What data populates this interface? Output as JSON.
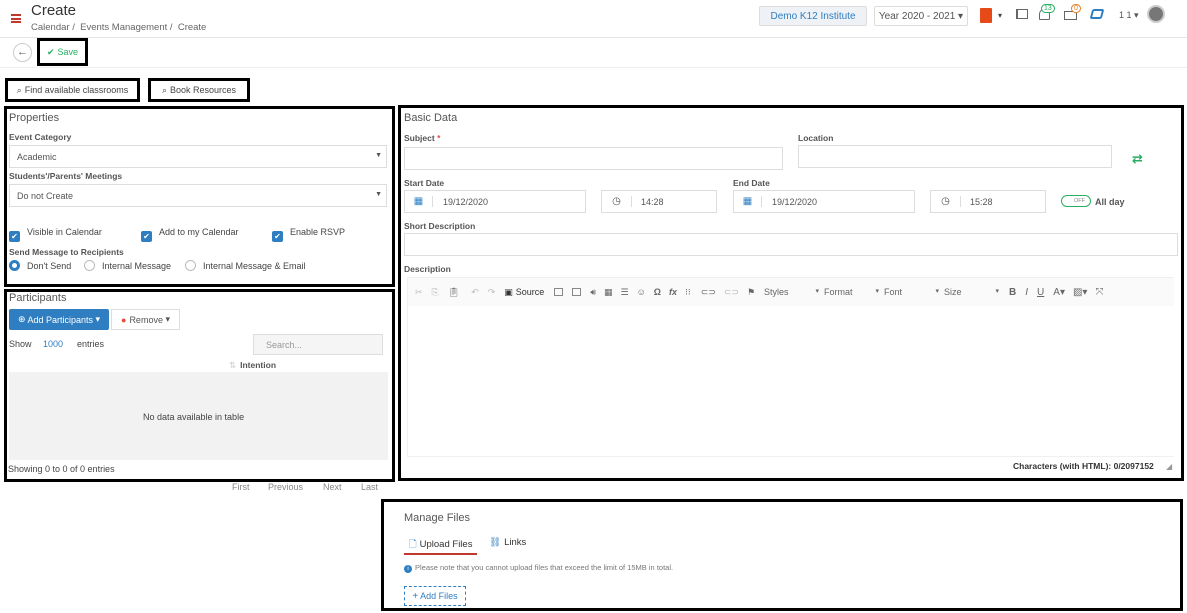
{
  "header": {
    "title": "Create",
    "breadcrumbs": [
      "Calendar",
      "Events Management",
      "Create"
    ],
    "institute": "Demo K12 Institute",
    "year": "Year 2020 - 2021",
    "notif_count": "13",
    "msg_count": "0",
    "user": "1 1"
  },
  "toolbar": {
    "save": "Save"
  },
  "actions": {
    "find_classrooms": "Find available classrooms",
    "book_resources": "Book Resources"
  },
  "properties": {
    "title": "Properties",
    "event_category_label": "Event Category",
    "event_category_value": "Academic",
    "meetings_label": "Students'/Parents' Meetings",
    "meetings_value": "Do not Create",
    "checks": [
      "Visible in Calendar",
      "Add to my Calendar",
      "Enable RSVP"
    ],
    "send_label": "Send Message to Recipients",
    "radios": [
      "Don't Send",
      "Internal Message",
      "Internal Message & Email"
    ]
  },
  "participants": {
    "title": "Participants",
    "add": "Add Participants",
    "remove": "Remove",
    "show": "Show",
    "entries_count": "1000",
    "entries": "entries",
    "search_placeholder": "Search...",
    "col_intention": "Intention",
    "empty": "No data available in table",
    "info": "Showing 0 to 0 of 0 entries",
    "pager": [
      "First",
      "Previous",
      "Next",
      "Last"
    ]
  },
  "basic": {
    "title": "Basic Data",
    "subject": "Subject",
    "required": "*",
    "location": "Location",
    "start_date_label": "Start Date",
    "start_date": "19/12/2020",
    "start_time": "14:28",
    "end_date_label": "End Date",
    "end_date": "19/12/2020",
    "end_time": "15:28",
    "toggle": "OFF",
    "all_day": "All day",
    "short_desc": "Short Description",
    "description": "Description",
    "source": "Source",
    "styles": "Styles",
    "format": "Format",
    "font": "Font",
    "size": "Size",
    "chars": "Characters (with HTML): 0/2097152"
  },
  "files": {
    "title": "Manage Files",
    "tab_upload": "Upload Files",
    "tab_links": "Links",
    "note": "Please note that you cannot upload files that exceed the limit of 15MB in total.",
    "add": "Add Files"
  },
  "colors": {
    "brand_red": "#c0392b",
    "blue": "#2f7ec1",
    "green": "#27ae60"
  }
}
